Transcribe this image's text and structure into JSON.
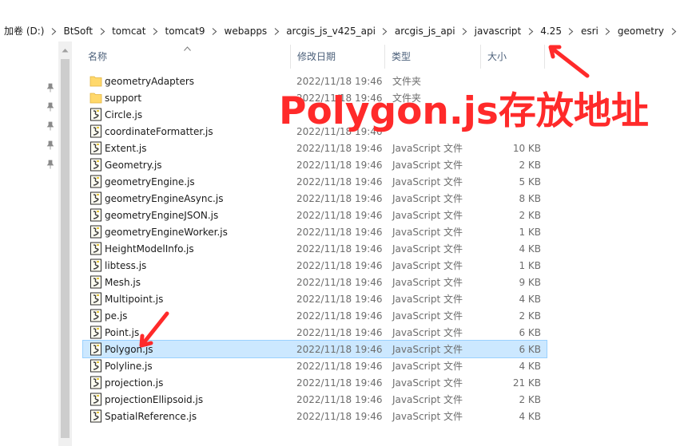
{
  "breadcrumbs": [
    "加卷 (D:)",
    "BtSoft",
    "tomcat",
    "tomcat9",
    "webapps",
    "arcgis_js_v425_api",
    "arcgis_js_api",
    "javascript",
    "4.25",
    "esri",
    "geometry"
  ],
  "columns": {
    "name": "名称",
    "date": "修改日期",
    "type": "类型",
    "size": "大小"
  },
  "annotation_text": "Polygon.js存放地址",
  "files": [
    {
      "name": "geometryAdapters",
      "date": "2022/11/18 19:46",
      "type": "文件夹",
      "size": "",
      "kind": "folder"
    },
    {
      "name": "support",
      "date": "2022/11/18 19:46",
      "type": "文件夹",
      "size": "",
      "kind": "folder"
    },
    {
      "name": "Circle.js",
      "date": "",
      "type": "",
      "size": "",
      "kind": "js"
    },
    {
      "name": "coordinateFormatter.js",
      "date": "2022/11/18 19:46",
      "type": "",
      "size": "",
      "kind": "js"
    },
    {
      "name": "Extent.js",
      "date": "2022/11/18 19:46",
      "type": "JavaScript 文件",
      "size": "10 KB",
      "kind": "js"
    },
    {
      "name": "Geometry.js",
      "date": "2022/11/18 19:46",
      "type": "JavaScript 文件",
      "size": "2 KB",
      "kind": "js"
    },
    {
      "name": "geometryEngine.js",
      "date": "2022/11/18 19:46",
      "type": "JavaScript 文件",
      "size": "5 KB",
      "kind": "js"
    },
    {
      "name": "geometryEngineAsync.js",
      "date": "2022/11/18 19:46",
      "type": "JavaScript 文件",
      "size": "8 KB",
      "kind": "js"
    },
    {
      "name": "geometryEngineJSON.js",
      "date": "2022/11/18 19:46",
      "type": "JavaScript 文件",
      "size": "2 KB",
      "kind": "js"
    },
    {
      "name": "geometryEngineWorker.js",
      "date": "2022/11/18 19:46",
      "type": "JavaScript 文件",
      "size": "1 KB",
      "kind": "js"
    },
    {
      "name": "HeightModelInfo.js",
      "date": "2022/11/18 19:46",
      "type": "JavaScript 文件",
      "size": "4 KB",
      "kind": "js"
    },
    {
      "name": "libtess.js",
      "date": "2022/11/18 19:46",
      "type": "JavaScript 文件",
      "size": "1 KB",
      "kind": "js"
    },
    {
      "name": "Mesh.js",
      "date": "2022/11/18 19:46",
      "type": "JavaScript 文件",
      "size": "9 KB",
      "kind": "js"
    },
    {
      "name": "Multipoint.js",
      "date": "2022/11/18 19:46",
      "type": "JavaScript 文件",
      "size": "4 KB",
      "kind": "js"
    },
    {
      "name": "pe.js",
      "date": "2022/11/18 19:46",
      "type": "JavaScript 文件",
      "size": "2 KB",
      "kind": "js"
    },
    {
      "name": "Point.js",
      "date": "2022/11/18 19:46",
      "type": "JavaScript 文件",
      "size": "6 KB",
      "kind": "js"
    },
    {
      "name": "Polygon.js",
      "date": "2022/11/18 19:46",
      "type": "JavaScript 文件",
      "size": "6 KB",
      "kind": "js",
      "selected": true
    },
    {
      "name": "Polyline.js",
      "date": "2022/11/18 19:46",
      "type": "JavaScript 文件",
      "size": "4 KB",
      "kind": "js"
    },
    {
      "name": "projection.js",
      "date": "2022/11/18 19:46",
      "type": "JavaScript 文件",
      "size": "21 KB",
      "kind": "js"
    },
    {
      "name": "projectionEllipsoid.js",
      "date": "2022/11/18 19:46",
      "type": "JavaScript 文件",
      "size": "2 KB",
      "kind": "js"
    },
    {
      "name": "SpatialReference.js",
      "date": "2022/11/18 19:46",
      "type": "JavaScript 文件",
      "size": "4 KB",
      "kind": "js"
    }
  ],
  "colors": {
    "selection": "#cce8ff",
    "annotation": "#ff2a2a",
    "folder": "#ffd86b"
  }
}
